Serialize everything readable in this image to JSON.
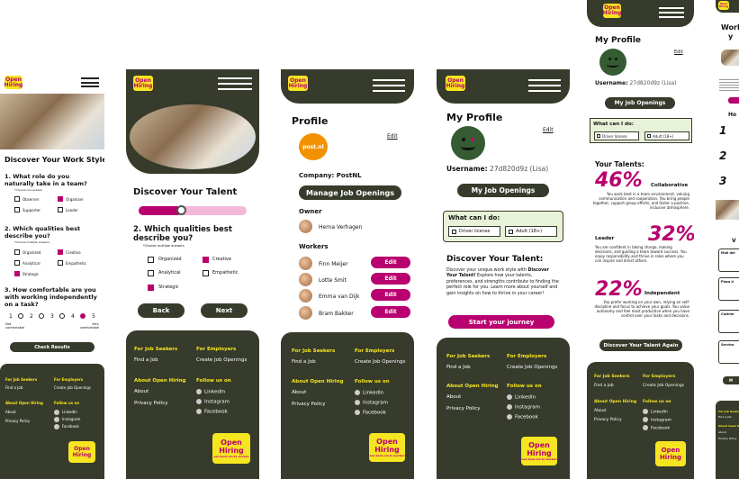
{
  "brand": {
    "logo_line1": "Open",
    "logo_line2": "Hiring"
  },
  "s1": {
    "title": "Discover Your Work Style",
    "q1": "1. What role do you naturally take in a team?",
    "q1_note": "*Choose one answer",
    "q1_opts": [
      "Observer",
      "Organizer",
      "Supporter",
      "Leader"
    ],
    "q2": "2. Which qualities best describe you?",
    "q2_note": "*Choose multiple answers",
    "q2_opts": [
      "Organized",
      "Creative",
      "Analytical",
      "Empathetic",
      "Strategic"
    ],
    "q3": "3. How comfortable are you with working independently on a task?",
    "scale": [
      "1",
      "2",
      "3",
      "4",
      "5"
    ],
    "scale_low": "Not comfortable",
    "scale_high": "Very comfortable",
    "check": "Check Results"
  },
  "s2": {
    "title": "Discover Your Talent",
    "progress": 0.4,
    "q": "2. Which qualities best describe you?",
    "note": "*Choose multiple answers",
    "opts": [
      "Organized",
      "Creative",
      "Analytical",
      "Empathetic",
      "Strategic"
    ],
    "back": "Back",
    "next": "Next"
  },
  "s3": {
    "title": "Profile",
    "edit": "Edit",
    "company_label": "Company:",
    "company": "PostNL",
    "logo_text": "post.nl",
    "manage": "Manage Job Openings",
    "owner_h": "Owner",
    "owner": "Herna Verhagen",
    "workers_h": "Workers",
    "workers": [
      "Finn Meijer",
      "Lotte Smit",
      "Emma van Dijk",
      "Bram Bakker"
    ],
    "worker_btn": "Edit"
  },
  "s4": {
    "title": "My Profile",
    "edit": "Edit",
    "user_label": "Username:",
    "user": "27d820d9z (Lisa)",
    "my_jobs": "My Job Openings",
    "can_h": "What can I do:",
    "can": [
      "Driver license",
      "Adult (18+)"
    ],
    "disc_h": "Discover Your Talent:",
    "disc_intro": "Discover your unique work style with",
    "disc_bold": "Discover Your Talent!",
    "disc_rest": "Explore how your talents, preferences, and strengths contribute to finding the perfect role for you. Learn more about yourself and gain insights on how to thrive in your career!",
    "start": "Start your journey"
  },
  "s5": {
    "title": "My Profile",
    "edit": "Edit",
    "user_label": "Username:",
    "user": "27d820d9z (Lisa)",
    "my_jobs": "My Job Openings",
    "can_h": "What can I do:",
    "can": [
      "Driver license",
      "Adult (18+)"
    ],
    "talents_h": "Your Talents:",
    "t1_pct": "46%",
    "t1_name": "Collaborative",
    "t1_text": "You work best in a team environment, valuing communication and cooperation. You bring people together, support group efforts, and foster a positive, inclusive atmosphere.",
    "t2_name": "Leader",
    "t2_pct": "32%",
    "t2_text": "You are confident in taking charge, making decisions, and guiding a team toward success. You enjoy responsibility and thrive in roles where you can inspire and direct others.",
    "t3_pct": "22%",
    "t3_name": "Independent",
    "t3_text": "You prefer working on your own, relying on self-discipline and focus to achieve your goals. You value autonomy and feel most productive when you have control over your tasks and decisions.",
    "again": "Discover Your Talent Again"
  },
  "s6": {
    "title_part": "Worl",
    "title_part2": "y",
    "how_part": "Ho",
    "steps": [
      "1",
      "2",
      "3"
    ],
    "jobs_h": "V",
    "job_titles": [
      "Mail del",
      "Pizza d",
      "Cashier",
      "Service"
    ],
    "more": "M"
  },
  "footer": {
    "seekers_h": "For Job Seekers",
    "find": "Find a Job",
    "employers_h": "For Employers",
    "create": "Create Job Openings",
    "about_h": "About Open Hiring",
    "about": "About",
    "privacy": "Privacy Policy",
    "follow_h": "Follow us on",
    "social": [
      "LinkedIn",
      "Instagram",
      "Facebook"
    ],
    "tagline": "een kans om te werken"
  }
}
